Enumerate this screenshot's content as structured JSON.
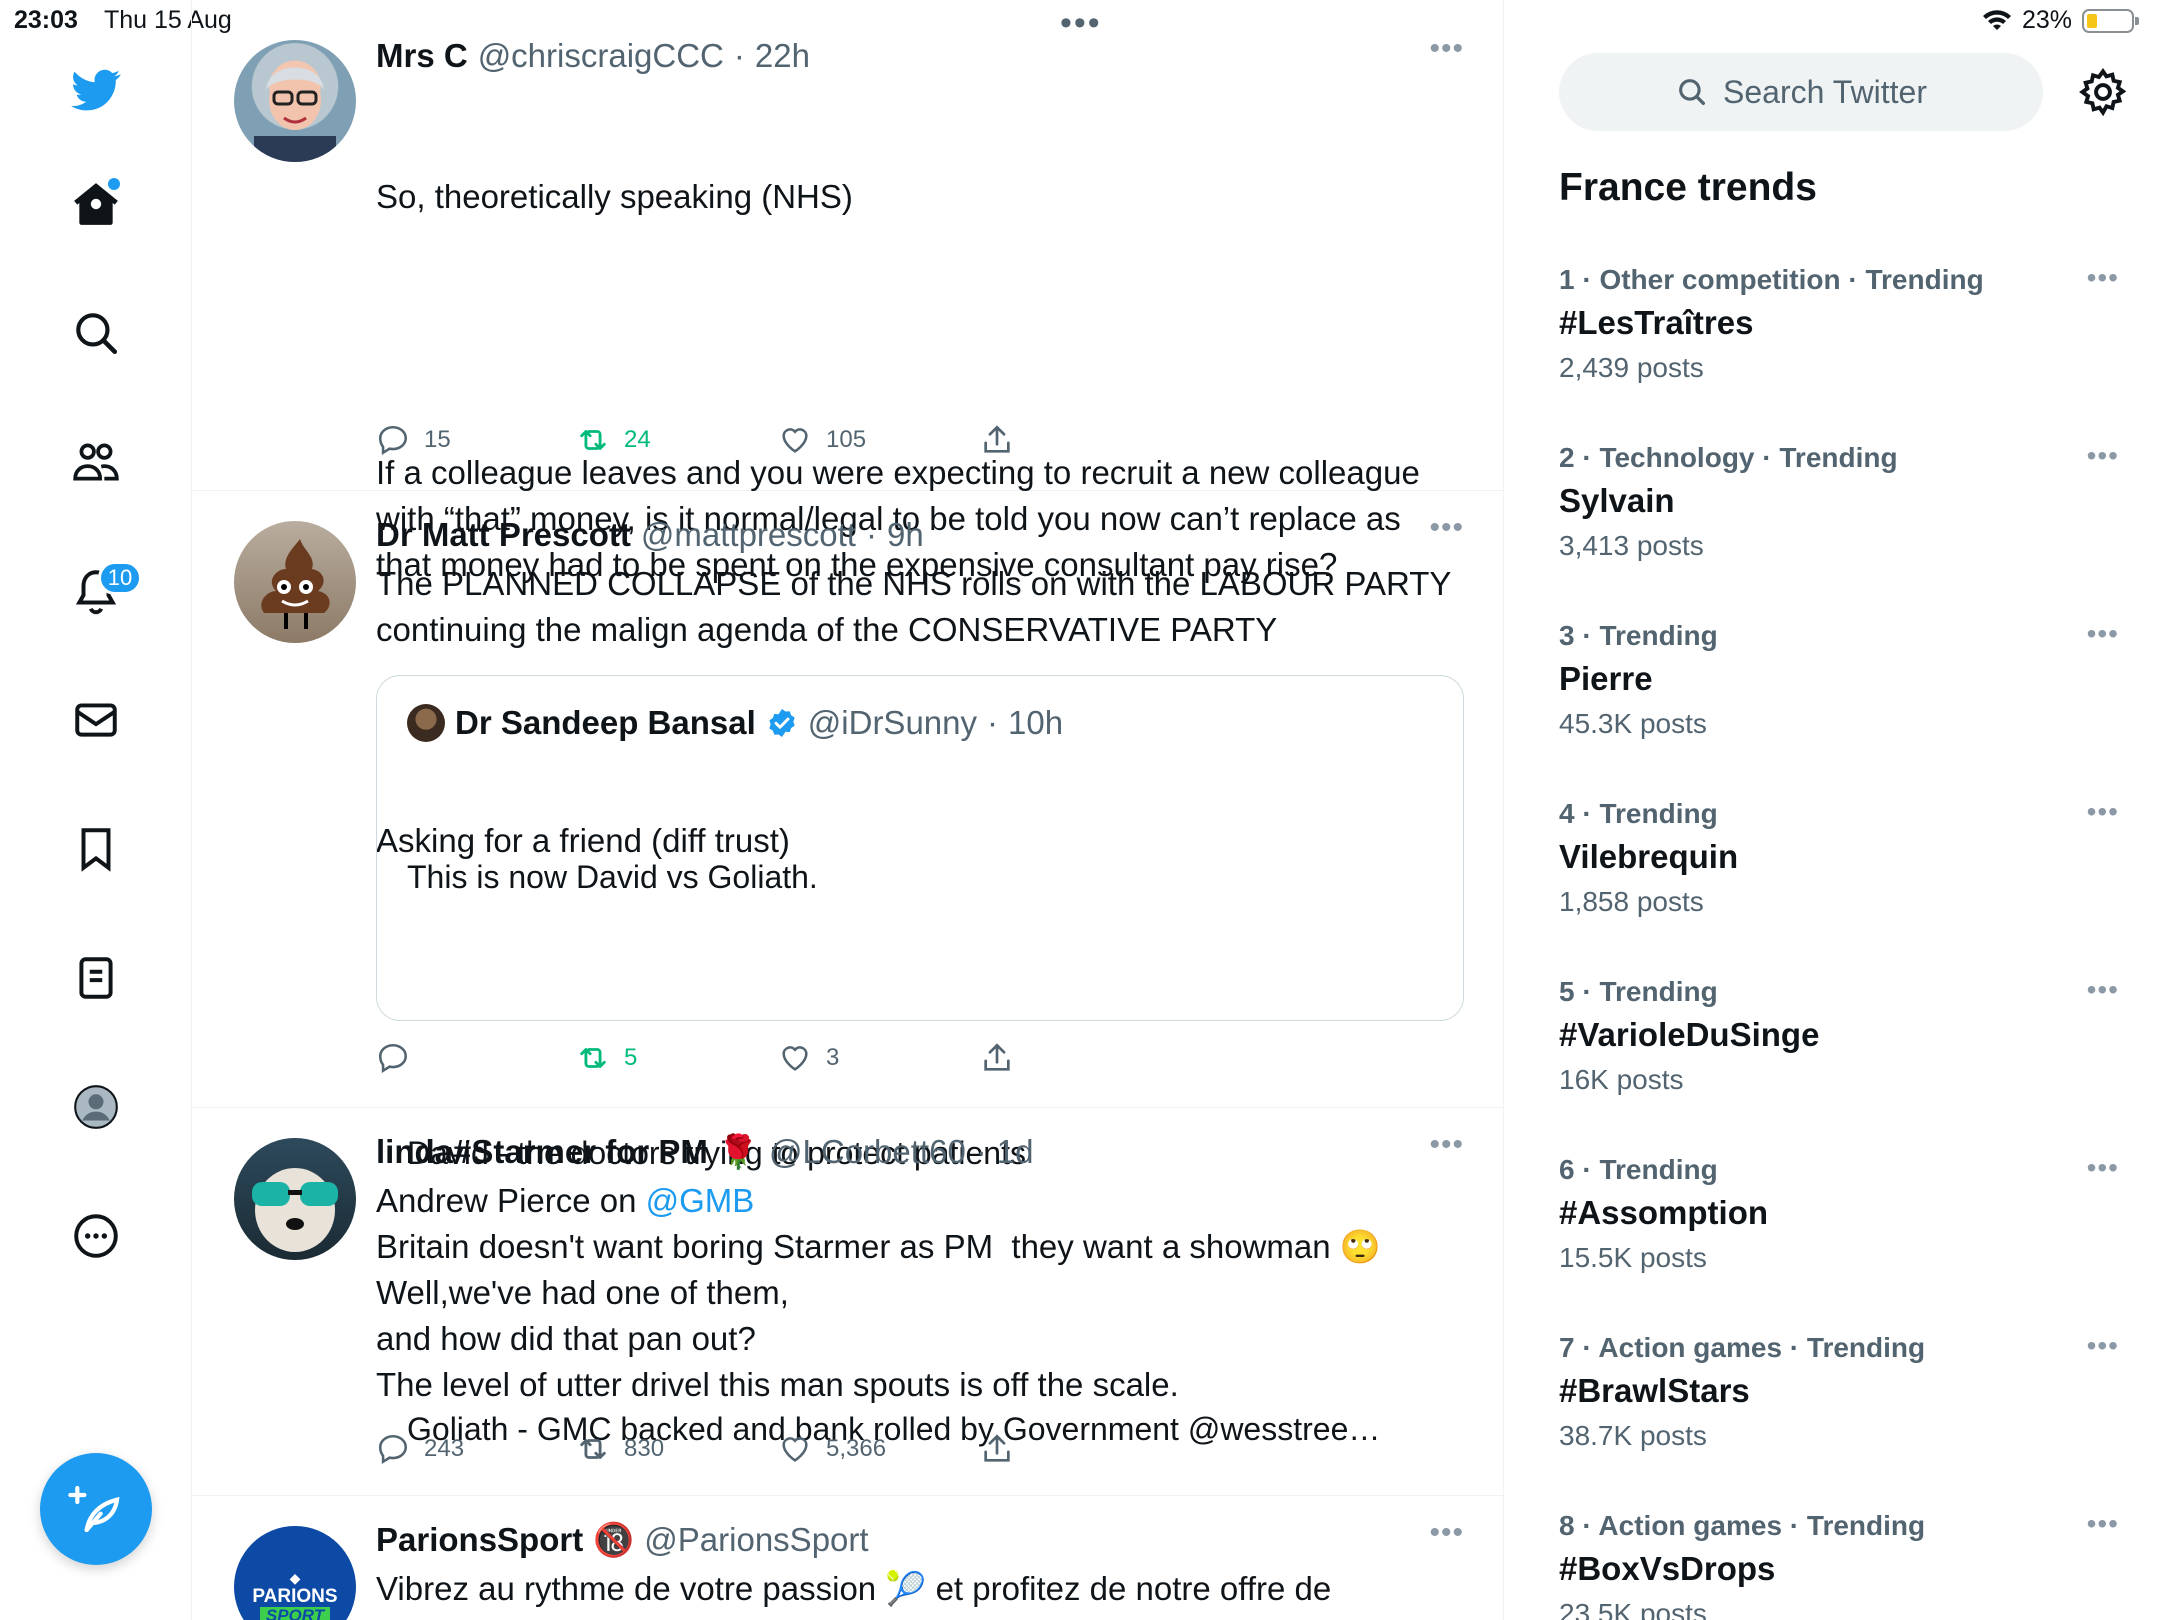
{
  "status": {
    "time": "23:03",
    "date": "Thu 15 Aug",
    "battery": "23%",
    "dots": "•••"
  },
  "nav": {
    "notifications_badge": "10"
  },
  "tweets": [
    {
      "name": "Mrs C",
      "handle": "@chriscraigCCC",
      "time": "22h",
      "text": "So, theoretically speaking (NHS)",
      "text2": "If a colleague leaves and you were expecting to recruit a new colleague with “that” money, is it normal/legal to be told you now can’t replace as that money had to be spent on the expensive consultant pay rise?",
      "text3": "Asking for a friend (diff trust)",
      "replies": "15",
      "retweets": "24",
      "likes": "105"
    },
    {
      "name": "Dr Matt Prescott",
      "handle": "@mattprescott",
      "time": "9h",
      "text": "The PLANNED COLLAPSE of the NHS rolls on with the LABOUR PARTY continuing the malign agenda of the CONSERVATIVE PARTY",
      "quote": {
        "name": "Dr Sandeep Bansal",
        "handle": "@iDrSunny",
        "time": "10h",
        "line1": "This is now David vs Goliath.",
        "line2": "David - the doctors trying to protect patients",
        "line3": "Goliath - GMC backed and bank rolled by Government @wesstree…"
      },
      "replies": "",
      "retweets": "5",
      "likes": "3"
    },
    {
      "name": "linda#Starmer for PM",
      "name_emoji": "🌹",
      "handle": "@LCorbett60",
      "time": "1d",
      "text_pre": "Andrew Pierce on ",
      "mention": "@GMB",
      "text": "Britain doesn't want boring Starmer as PM  they want a showman 🙄\nWell,we've had one of them,\nand how did that pan out?\nThe level of utter drivel this man spouts is off the scale.",
      "replies": "243",
      "retweets": "830",
      "likes": "5,366"
    },
    {
      "name": "ParionsSport",
      "name_emoji": "🔞",
      "handle": "@ParionsSport",
      "text": "Vibrez au rythme de votre passion 🎾 et profitez de notre offre de",
      "avatar_text1": "PARIONS",
      "avatar_text2": "SPORT"
    }
  ],
  "sidebar": {
    "search_placeholder": "Search Twitter",
    "trends_title": "France trends",
    "trends": [
      {
        "meta": "1 · Other competition · Trending",
        "name": "#LesTraîtres",
        "posts": "2,439 posts"
      },
      {
        "meta": "2 · Technology · Trending",
        "name": "Sylvain",
        "posts": "3,413 posts"
      },
      {
        "meta": "3 · Trending",
        "name": "Pierre",
        "posts": "45.3K posts"
      },
      {
        "meta": "4 · Trending",
        "name": "Vilebrequin",
        "posts": "1,858 posts"
      },
      {
        "meta": "5 · Trending",
        "name": "#VarioleDuSinge",
        "posts": "16K posts"
      },
      {
        "meta": "6 · Trending",
        "name": "#Assomption",
        "posts": "15.5K posts"
      },
      {
        "meta": "7 · Action games · Trending",
        "name": "#BrawlStars",
        "posts": "38.7K posts"
      },
      {
        "meta": "8 · Action games · Trending",
        "name": "#BoxVsDrops",
        "posts": "23.5K posts"
      }
    ]
  },
  "colors": {
    "accent": "#1d9bf0",
    "retweet": "#00ba7c",
    "muted": "#536471"
  }
}
